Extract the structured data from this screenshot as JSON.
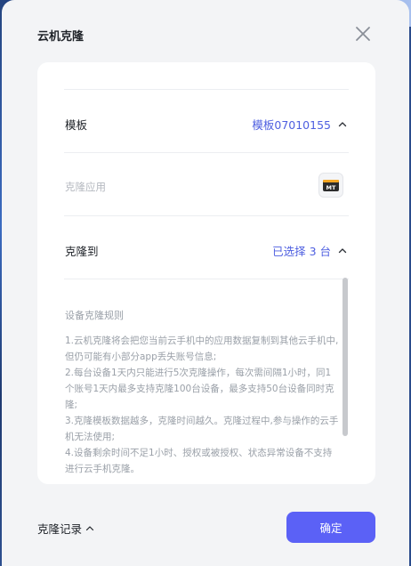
{
  "dialog": {
    "title": "云机克隆",
    "close_icon": "close-icon"
  },
  "template_row": {
    "label": "模板",
    "value": "模板07010155",
    "chevron": "chevron-up-icon"
  },
  "clone_app_row": {
    "label": "克隆应用",
    "app_icon": "app-icon-mt",
    "app_icon_text": "MT"
  },
  "clone_to_row": {
    "label": "克隆到",
    "value": "已选择 3 台",
    "chevron": "chevron-up-icon"
  },
  "rules": {
    "title": "设备克隆规则",
    "items": [
      "1.云机克隆将会把您当前云手机中的应用数据复制到其他云手机中,但仍可能有小部分app丢失账号信息;",
      "2.每台设备1天内只能进行5次克隆操作，每次需间隔1小时，同1个账号1天内最多支持克隆100台设备，最多支持50台设备同时克隆;",
      "3.克隆模板数据越多，克隆时间越久。克隆过程中,参与操作的云手机无法使用;",
      "4.设备剩余时间不足1小时、授权或被授权、状态异常设备不支持进行云手机克隆。"
    ]
  },
  "footer": {
    "history_label": "克隆记录",
    "confirm_label": "确定"
  },
  "colors": {
    "accent": "#5b61f6",
    "link": "#4e5fe0",
    "muted_text": "#9aa0a8"
  }
}
